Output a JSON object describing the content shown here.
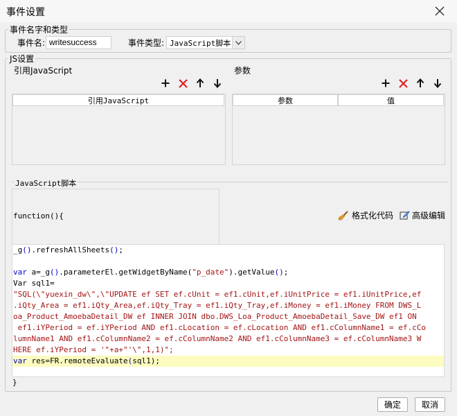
{
  "window": {
    "title": "事件设置"
  },
  "event_group": {
    "legend": "事件名字和类型",
    "name_label": "事件名:",
    "name_value": "writesuccess",
    "type_label": "事件类型:",
    "type_value": "JavaScript脚本"
  },
  "js_group": {
    "legend": "JS设置",
    "ref_section": {
      "label": "引用JavaScript",
      "column": "引用JavaScript"
    },
    "param_section": {
      "label": "参数",
      "columns": [
        "参数",
        "值"
      ]
    },
    "script_label": "JavaScript脚本",
    "function_header": "function(){",
    "format_label": "格式化代码",
    "advanced_label": "高级编辑",
    "code_lines": [
      "_g().refreshAllSheets();",
      "",
      "var a=_g().parameterEl.getWidgetByName(\"p_date\").getValue();",
      "Var sql1=",
      "\"SQL(\\\"yuexin_dw\\\",\\\"UPDATE ef SET ef.cUnit = ef1.cUnit,ef.iUnitPrice = ef1.iUnitPrice,ef",
      ".iQty_Area = ef1.iQty_Area,ef.iQty_Tray = ef1.iQty_Tray,ef.iMoney = ef1.iMoney FROM DWS_L",
      "oa_Product_AmoebaDetail_DW ef INNER JOIN dbo.DWS_Loa_Product_AmoebaDetail_Save_DW ef1 ON",
      " ef1.iYPeriod = ef.iYPeriod AND ef1.cLocation = ef.cLocation AND ef1.cColumnName1 = ef.cCo",
      "lumnName1 AND ef1.cColumnName2 = ef.cColumnName2 AND ef1.cColumnName3 = ef.cColumnName3 W",
      "HERE ef.iYPeriod = '\"+a+\"'\\\",1,1)\";",
      "var res=FR.remoteEvaluate(sql1);"
    ],
    "closing_brace": "}"
  },
  "buttons": {
    "ok": "确定",
    "cancel": "取消"
  }
}
